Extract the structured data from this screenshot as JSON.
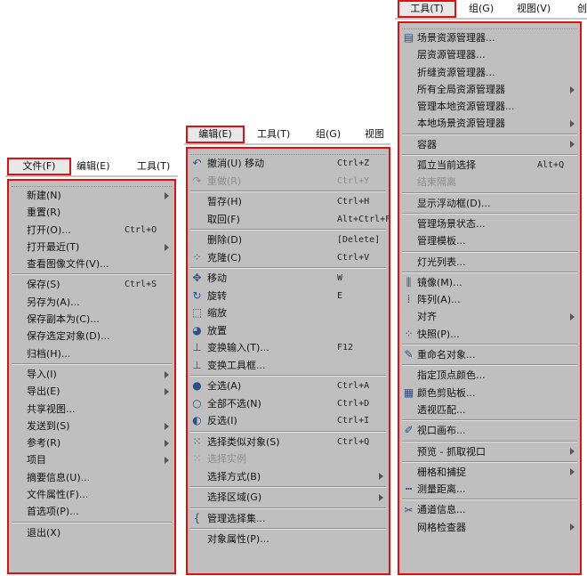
{
  "file_menu": {
    "menubar": [
      "文件(F)",
      "编辑(E)",
      "工具(T)"
    ],
    "items": [
      {
        "label": "新建(N)",
        "arrow": true
      },
      {
        "label": "重置(R)"
      },
      {
        "label": "打开(O)...",
        "shortcut": "Ctrl+O"
      },
      {
        "label": "打开最近(T)",
        "arrow": true
      },
      {
        "label": "查看图像文件(V)..."
      },
      {
        "sep": true
      },
      {
        "label": "保存(S)",
        "shortcut": "Ctrl+S"
      },
      {
        "label": "另存为(A)..."
      },
      {
        "label": "保存副本为(C)..."
      },
      {
        "label": "保存选定对象(D)..."
      },
      {
        "label": "归档(H)..."
      },
      {
        "sep": true
      },
      {
        "label": "导入(I)",
        "arrow": true
      },
      {
        "label": "导出(E)",
        "arrow": true
      },
      {
        "label": "共享视图..."
      },
      {
        "label": "发送到(S)",
        "arrow": true
      },
      {
        "label": "参考(R)",
        "arrow": true
      },
      {
        "label": "项目",
        "arrow": true
      },
      {
        "label": "摘要信息(U)..."
      },
      {
        "label": "文件属性(F)..."
      },
      {
        "label": "首选项(P)..."
      },
      {
        "sep": true
      },
      {
        "label": "退出(X)"
      }
    ]
  },
  "edit_menu": {
    "menubar": [
      "编辑(E)",
      "工具(T)",
      "组(G)",
      "视图"
    ],
    "items": [
      {
        "label": "撤消(U) 移动",
        "shortcut": "Ctrl+Z",
        "icon": "undo-icon",
        "glyph": "↶"
      },
      {
        "label": "重做(R)",
        "shortcut": "Ctrl+Y",
        "icon": "redo-icon",
        "glyph": "↷",
        "disabled": true
      },
      {
        "sep": true
      },
      {
        "label": "暂存(H)",
        "shortcut": "Ctrl+H"
      },
      {
        "label": "取回(F)",
        "shortcut": "Alt+Ctrl+F"
      },
      {
        "sep": true
      },
      {
        "label": "删除(D)",
        "shortcut": "[Delete]"
      },
      {
        "label": "克隆(C)",
        "shortcut": "Ctrl+V",
        "icon": "clone-icon",
        "glyph": "⁘"
      },
      {
        "sep": true
      },
      {
        "label": "移动",
        "shortcut": "W",
        "icon": "move-icon",
        "glyph": "✥"
      },
      {
        "label": "旋转",
        "shortcut": "E",
        "icon": "rotate-icon",
        "glyph": "↻"
      },
      {
        "label": "缩放",
        "icon": "scale-icon",
        "glyph": "⬚"
      },
      {
        "label": "放置",
        "icon": "place-icon",
        "glyph": "◕"
      },
      {
        "label": "变换输入(T)...",
        "shortcut": "F12",
        "icon": "transform-input-icon",
        "glyph": "⊥"
      },
      {
        "label": "变换工具框...",
        "icon": "transform-toolbox-icon",
        "glyph": "⊥"
      },
      {
        "sep": true
      },
      {
        "label": "全选(A)",
        "shortcut": "Ctrl+A",
        "icon": "select-all-icon",
        "glyph": "●"
      },
      {
        "label": "全部不选(N)",
        "shortcut": "Ctrl+D",
        "icon": "select-none-icon",
        "glyph": "○"
      },
      {
        "label": "反选(I)",
        "shortcut": "Ctrl+I",
        "icon": "select-invert-icon",
        "glyph": "◐"
      },
      {
        "sep": true
      },
      {
        "label": "选择类似对象(S)",
        "shortcut": "Ctrl+Q",
        "icon": "select-similar-icon",
        "glyph": "⁙"
      },
      {
        "label": "选择实例",
        "icon": "select-instance-icon",
        "glyph": "⁙",
        "disabled": true
      },
      {
        "label": "选择方式(B)",
        "arrow": true
      },
      {
        "sep": true
      },
      {
        "label": "选择区域(G)",
        "arrow": true
      },
      {
        "sep": true
      },
      {
        "label": "管理选择集...",
        "icon": "selection-sets-icon",
        "glyph": "{"
      },
      {
        "sep": true
      },
      {
        "label": "对象属性(P)..."
      }
    ]
  },
  "tools_menu": {
    "menubar": [
      "工具(T)",
      "组(G)",
      "视图(V)",
      "创"
    ],
    "items": [
      {
        "label": "场景资源管理器...",
        "icon": "scene-explorer-icon",
        "glyph": "▤"
      },
      {
        "label": "层资源管理器..."
      },
      {
        "label": "折缝资源管理器..."
      },
      {
        "label": "所有全局资源管理器",
        "arrow": true
      },
      {
        "label": "管理本地资源管理器..."
      },
      {
        "label": "本地场景资源管理器",
        "arrow": true
      },
      {
        "sep": true
      },
      {
        "label": "容器",
        "arrow": true
      },
      {
        "sep": true
      },
      {
        "label": "孤立当前选择",
        "shortcut": "Alt+Q"
      },
      {
        "label": "结束隔离",
        "disabled": true
      },
      {
        "sep": true
      },
      {
        "label": "显示浮动框(D)..."
      },
      {
        "sep": true
      },
      {
        "label": "管理场景状态..."
      },
      {
        "label": "管理模板..."
      },
      {
        "sep": true
      },
      {
        "label": "灯光列表..."
      },
      {
        "sep": true
      },
      {
        "label": "镜像(M)...",
        "icon": "mirror-icon",
        "glyph": "⫼"
      },
      {
        "label": "阵列(A)...",
        "icon": "array-icon",
        "glyph": "⁞"
      },
      {
        "label": "对齐",
        "arrow": true
      },
      {
        "label": "快照(P)...",
        "icon": "snapshot-icon",
        "glyph": "⁘"
      },
      {
        "sep": true
      },
      {
        "label": "重命名对象...",
        "icon": "rename-icon",
        "glyph": "✎"
      },
      {
        "sep": true
      },
      {
        "label": "指定顶点颜色..."
      },
      {
        "label": "颜色剪贴板...",
        "icon": "color-clipboard-icon",
        "glyph": "▦"
      },
      {
        "label": "透视匹配..."
      },
      {
        "sep": true
      },
      {
        "label": "视口画布...",
        "icon": "viewport-canvas-icon",
        "glyph": "✐"
      },
      {
        "sep": true
      },
      {
        "label": "预览 - 抓取视口",
        "arrow": true
      },
      {
        "sep": true
      },
      {
        "label": "栅格和捕捉",
        "arrow": true
      },
      {
        "label": "测量距离...",
        "icon": "measure-icon",
        "glyph": "┅"
      },
      {
        "sep": true
      },
      {
        "label": "通道信息...",
        "icon": "channel-info-icon",
        "glyph": "✂"
      },
      {
        "label": "网格检查器",
        "arrow": true
      }
    ]
  }
}
